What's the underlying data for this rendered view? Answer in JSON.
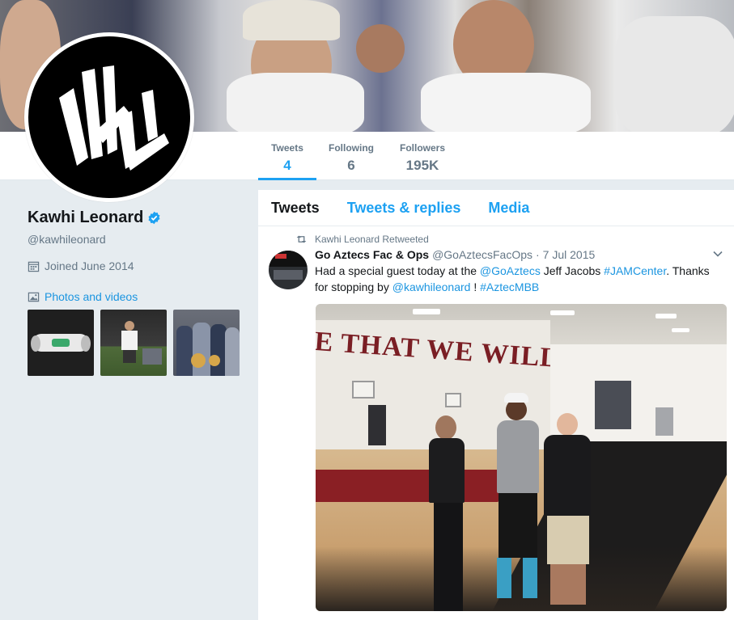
{
  "profile_nav": {
    "tweets": {
      "label": "Tweets",
      "value": "4"
    },
    "following": {
      "label": "Following",
      "value": "6"
    },
    "followers": {
      "label": "Followers",
      "value": "195K"
    }
  },
  "profile": {
    "name": "Kawhi Leonard",
    "handle": "@kawhileonard",
    "joined": "Joined June 2014",
    "photos_link": "Photos and videos"
  },
  "timeline": {
    "tabs": [
      "Tweets",
      "Tweets & replies",
      "Media"
    ],
    "tweet": {
      "retweet_context": "Kawhi Leonard Retweeted",
      "author_name": "Go Aztecs Fac & Ops",
      "author_handle": "@GoAztecsFacOps",
      "dot": "·",
      "date": "7 Jul 2015",
      "text_parts": {
        "p1": "Had a special guest today at the ",
        "mention1": "@GoAztecs",
        "p2": " Jeff Jacobs ",
        "hashtag1": "#JAMCenter",
        "p3": ". Thanks for stopping by ",
        "mention2": "@kawhileonard",
        "p4": " ! ",
        "hashtag2": "#AztecMBB"
      },
      "wall_text": "E THAT WE WILL WIN"
    }
  },
  "colors": {
    "accent": "#1da1f2",
    "link": "#1b95e0",
    "muted": "#657786",
    "background": "#e6ecf0"
  },
  "icons": [
    "verified-badge-icon",
    "calendar-icon",
    "photo-icon",
    "retweet-icon",
    "chevron-down-icon"
  ]
}
